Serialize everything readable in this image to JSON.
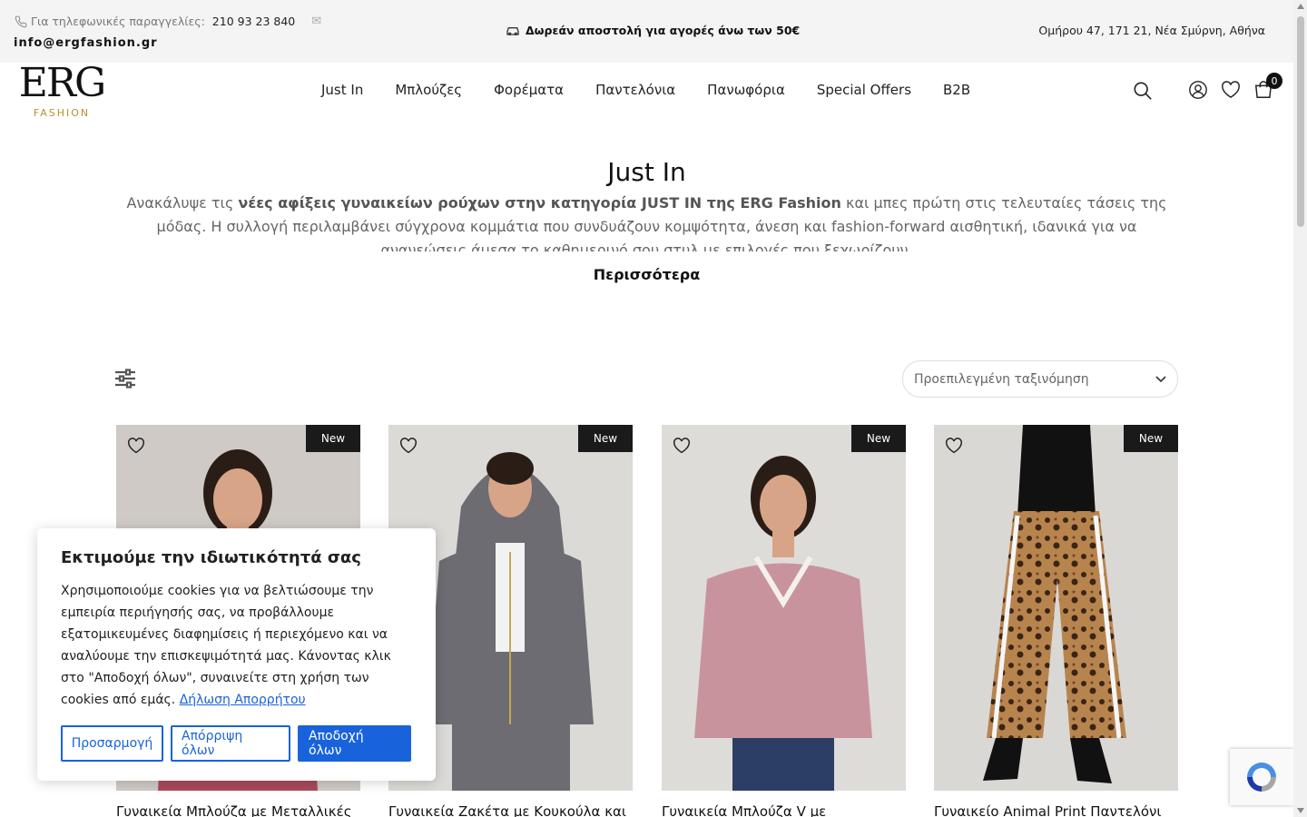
{
  "topbar": {
    "phone_label": "Για τηλεφωνικές παραγγελίες:",
    "phone_number": "210 93 23 840",
    "email": "info@ergfashion.gr",
    "shipping": "Δωρεάν αποστολή για αγορές άνω των 50€",
    "address": "Ομήρου 47, 171 21, Νέα Σμύρνη, Αθήνα"
  },
  "logo": {
    "main": "ERG",
    "sub": "FASHION"
  },
  "nav": [
    "Just In",
    "Μπλούζες",
    "Φορέματα",
    "Παντελόνια",
    "Πανωφόρια",
    "Special Offers",
    "B2B"
  ],
  "header": {
    "cart_count": "0"
  },
  "hero": {
    "title": "Just In",
    "desc_start": "Ανακάλυψε τις ",
    "desc_bold": "νέες αφίξεις γυναικείων ρούχων στην κατηγορία JUST IN της ERG Fashion",
    "desc_end": " και μπες πρώτη στις τελευταίες τάσεις της μόδας. Η συλλογή περιλαμβάνει σύγχρονα κομμάτια που συνδυάζουν κομψότητα, άνεση και fashion-forward αισθητική, ιδανικά για να ανανεώσεις άμεσα το καθημερινό σου στυλ με επιλογές που ξεχωρίζουν.",
    "more": "Περισσότερα"
  },
  "toolbar": {
    "sort_value": "Προεπιλεγμένη ταξινόμηση"
  },
  "products": [
    {
      "badge": "New",
      "name": "Γυναικεία Μπλούζα με Μεταλλικές",
      "color": "#cfcac6",
      "garment": "#a84a5a"
    },
    {
      "badge": "New",
      "name": "Γυναικεία Ζακέτα με Κουκούλα και",
      "color": "#dcdad7",
      "garment": "#6c6c72"
    },
    {
      "badge": "New",
      "name": "Γυναικεία Μπλούζα V με",
      "color": "#dedcd9",
      "garment": "#c9939e"
    },
    {
      "badge": "New",
      "name": "Γυναικείο Animal Print Παντελόνι",
      "color": "#dad8d5",
      "garment": "#9a6a3c"
    }
  ],
  "cookie": {
    "title": "Εκτιμούμε την ιδιωτικότητά σας",
    "text": "Χρησιμοποιούμε cookies για να βελτιώσουμε την εμπειρία περιήγησής σας, να προβάλλουμε εξατομικευμένες διαφημίσεις ή περιεχόμενο και να αναλύουμε την επισκεψιμότητά μας. Κάνοντας κλικ στο \"Αποδοχή όλων\", συναινείτε στη χρήση των cookies από εμάς.",
    "link": "Δήλωση Απορρήτου",
    "btn_customize": "Προσαρμογή",
    "btn_reject": "Απόρριψη όλων",
    "btn_accept": "Αποδοχή όλων"
  }
}
